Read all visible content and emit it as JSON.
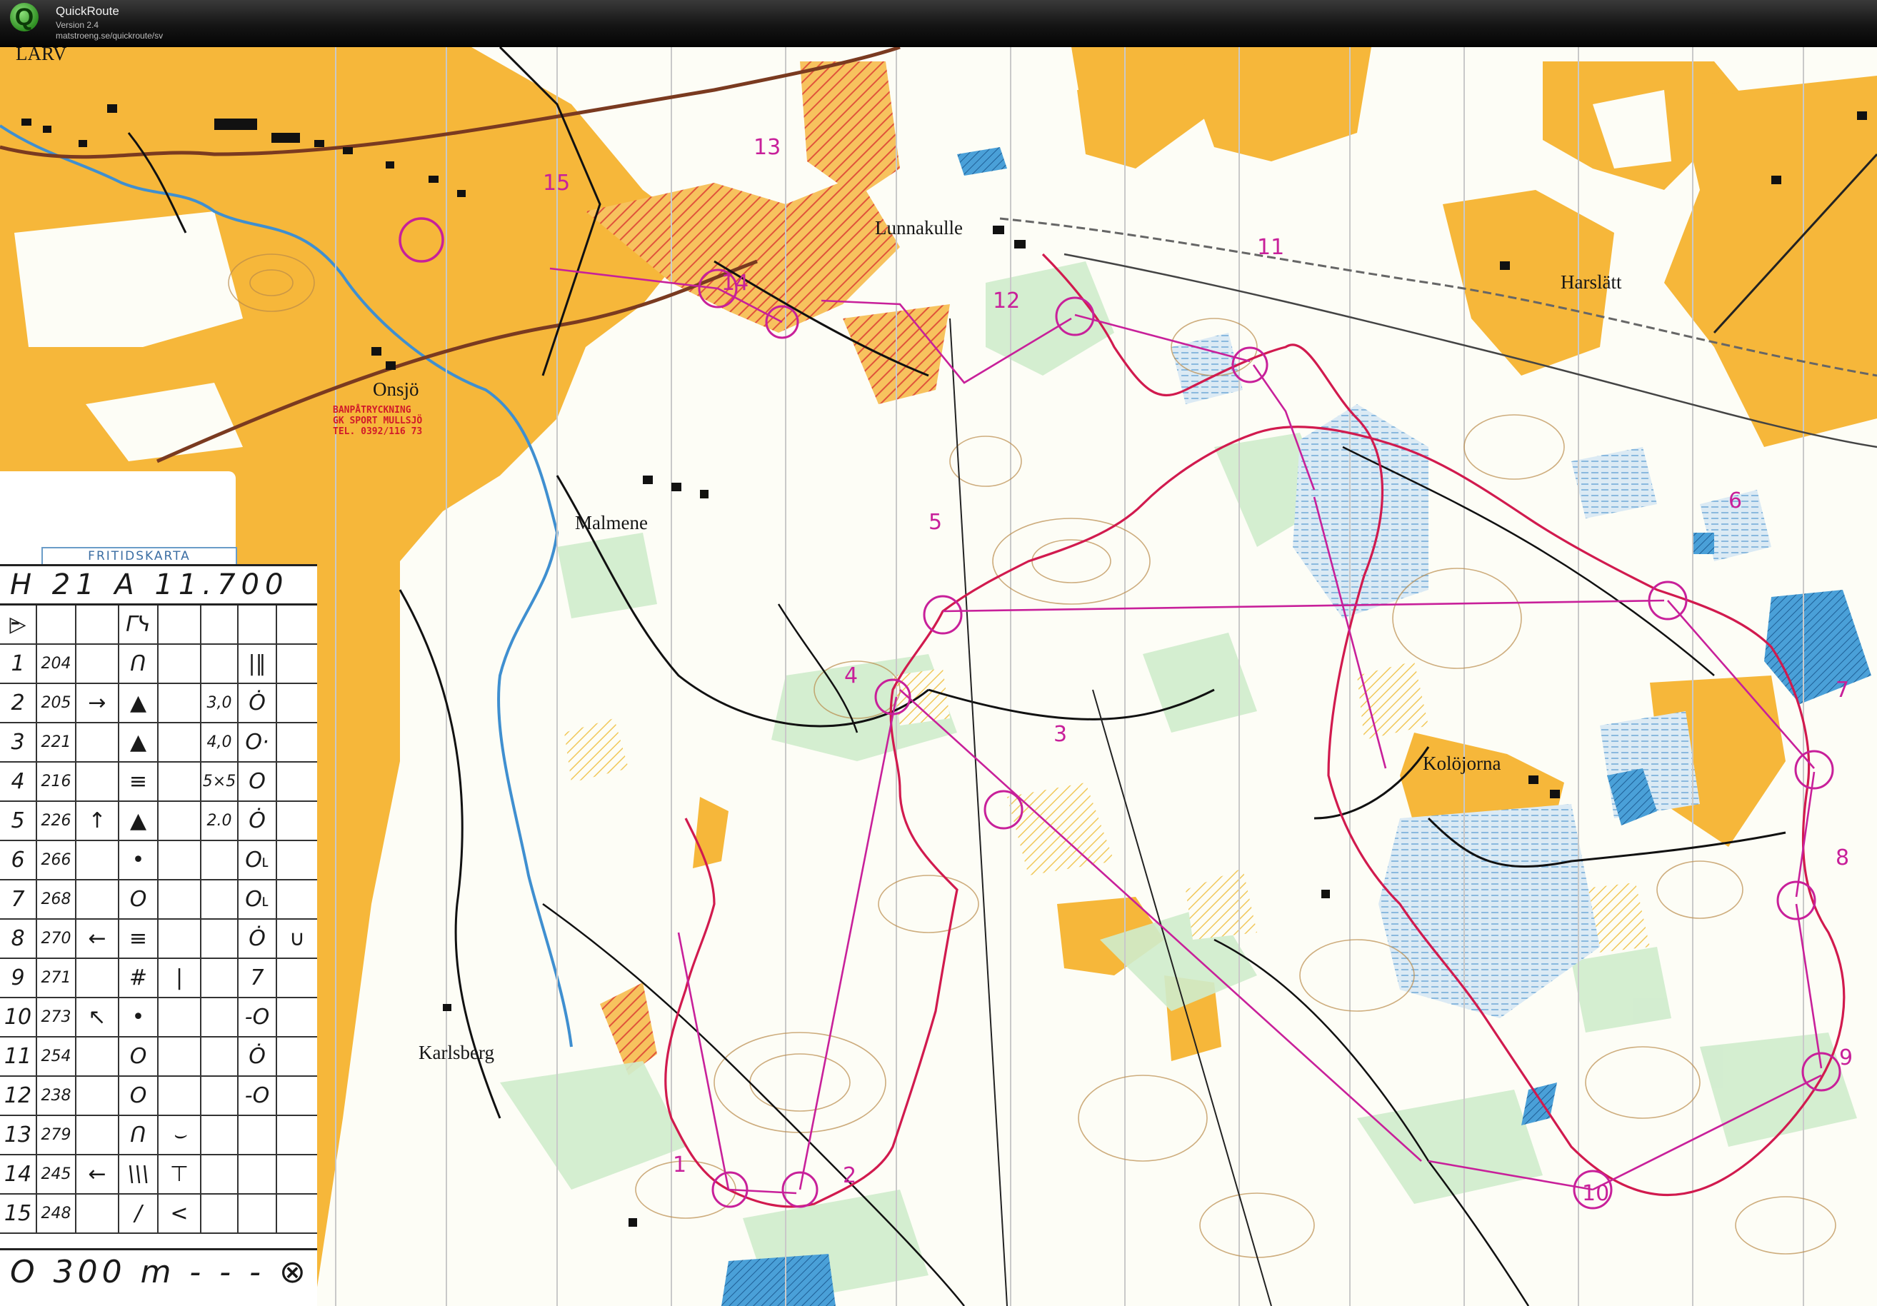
{
  "app": {
    "title": "QuickRoute",
    "version": "Version 2.4",
    "url": "matstroeng.se/quickroute/sv",
    "logo_letter": "Q"
  },
  "colors": {
    "open_land": "#f6b73a",
    "forest": "#fdfdf6",
    "green": "#cfeccc",
    "water": "#7cc0e8",
    "marsh": "#b9dcf0",
    "course": "#c8209a",
    "route": "#d11a4e",
    "road": "#111111"
  },
  "map": {
    "places": [
      {
        "label": "LARV"
      },
      {
        "label": "Lunnakulle"
      },
      {
        "label": "Harslätt"
      },
      {
        "label": "Onsjö"
      },
      {
        "label": "Malmene"
      },
      {
        "label": "Kolöjorna"
      },
      {
        "label": "Karlsberg"
      }
    ],
    "stamp": {
      "line1": "BANPÅTRYCKNING",
      "line2": "GK SPORT MULLSJÖ",
      "line3": "TEL. 0392/116 73"
    },
    "controls": [
      {
        "number": "1"
      },
      {
        "number": "2"
      },
      {
        "number": "3"
      },
      {
        "number": "4"
      },
      {
        "number": "5"
      },
      {
        "number": "6"
      },
      {
        "number": "7"
      },
      {
        "number": "8"
      },
      {
        "number": "9"
      },
      {
        "number": "10"
      },
      {
        "number": "11"
      },
      {
        "number": "12"
      },
      {
        "number": "13"
      },
      {
        "number": "14"
      },
      {
        "number": "15"
      }
    ]
  },
  "card": {
    "frame_label": "FRITIDSKARTA",
    "header": "H 21 A   11.700 -",
    "rows": [
      {
        "n": "▷",
        "code": "",
        "c2": "",
        "c3": "ᒥᓭ",
        "c4": "",
        "c5": "",
        "c6": "",
        "c7": ""
      },
      {
        "n": "1",
        "code": "204",
        "c2": "",
        "c3": "ᑎ",
        "c4": "",
        "c5": "",
        "c6": "|‖",
        "c7": ""
      },
      {
        "n": "2",
        "code": "205",
        "c2": "→",
        "c3": "▲",
        "c4": "",
        "c5": "3,0",
        "c6": "Ȯ",
        "c7": ""
      },
      {
        "n": "3",
        "code": "221",
        "c2": "",
        "c3": "▲",
        "c4": "",
        "c5": "4,0",
        "c6": "O·",
        "c7": ""
      },
      {
        "n": "4",
        "code": "216",
        "c2": "",
        "c3": "≡",
        "c4": "",
        "c5": "5×5",
        "c6": "O",
        "c7": ""
      },
      {
        "n": "5",
        "code": "226",
        "c2": "↑",
        "c3": "▲",
        "c4": "",
        "c5": "2.0",
        "c6": "Ȯ",
        "c7": ""
      },
      {
        "n": "6",
        "code": "266",
        "c2": "",
        "c3": "•",
        "c4": "",
        "c5": "",
        "c6": "O˪",
        "c7": ""
      },
      {
        "n": "7",
        "code": "268",
        "c2": "",
        "c3": "O",
        "c4": "",
        "c5": "",
        "c6": "O˪",
        "c7": ""
      },
      {
        "n": "8",
        "code": "270",
        "c2": "←",
        "c3": "≡",
        "c4": "",
        "c5": "",
        "c6": "Ȯ",
        "c7": "∪"
      },
      {
        "n": "9",
        "code": "271",
        "c2": "",
        "c3": "#",
        "c4": "|",
        "c5": "",
        "c6": "7",
        "c7": ""
      },
      {
        "n": "10",
        "code": "273",
        "c2": "↖",
        "c3": "•",
        "c4": "",
        "c5": "",
        "c6": "-O",
        "c7": ""
      },
      {
        "n": "11",
        "code": "254",
        "c2": "",
        "c3": "O",
        "c4": "",
        "c5": "",
        "c6": "Ȯ",
        "c7": ""
      },
      {
        "n": "12",
        "code": "238",
        "c2": "",
        "c3": "O",
        "c4": "",
        "c5": "",
        "c6": "-O",
        "c7": ""
      },
      {
        "n": "13",
        "code": "279",
        "c2": "",
        "c3": "ᑎ",
        "c4": "⌣",
        "c5": "",
        "c6": "",
        "c7": ""
      },
      {
        "n": "14",
        "code": "245",
        "c2": "←",
        "c3": "\\\\\\",
        "c4": "⊤",
        "c5": "",
        "c6": "",
        "c7": ""
      },
      {
        "n": "15",
        "code": "248",
        "c2": "",
        "c3": "/",
        "c4": "<",
        "c5": "",
        "c6": "",
        "c7": ""
      }
    ],
    "footer": "O 300 m - - - ⊗"
  }
}
